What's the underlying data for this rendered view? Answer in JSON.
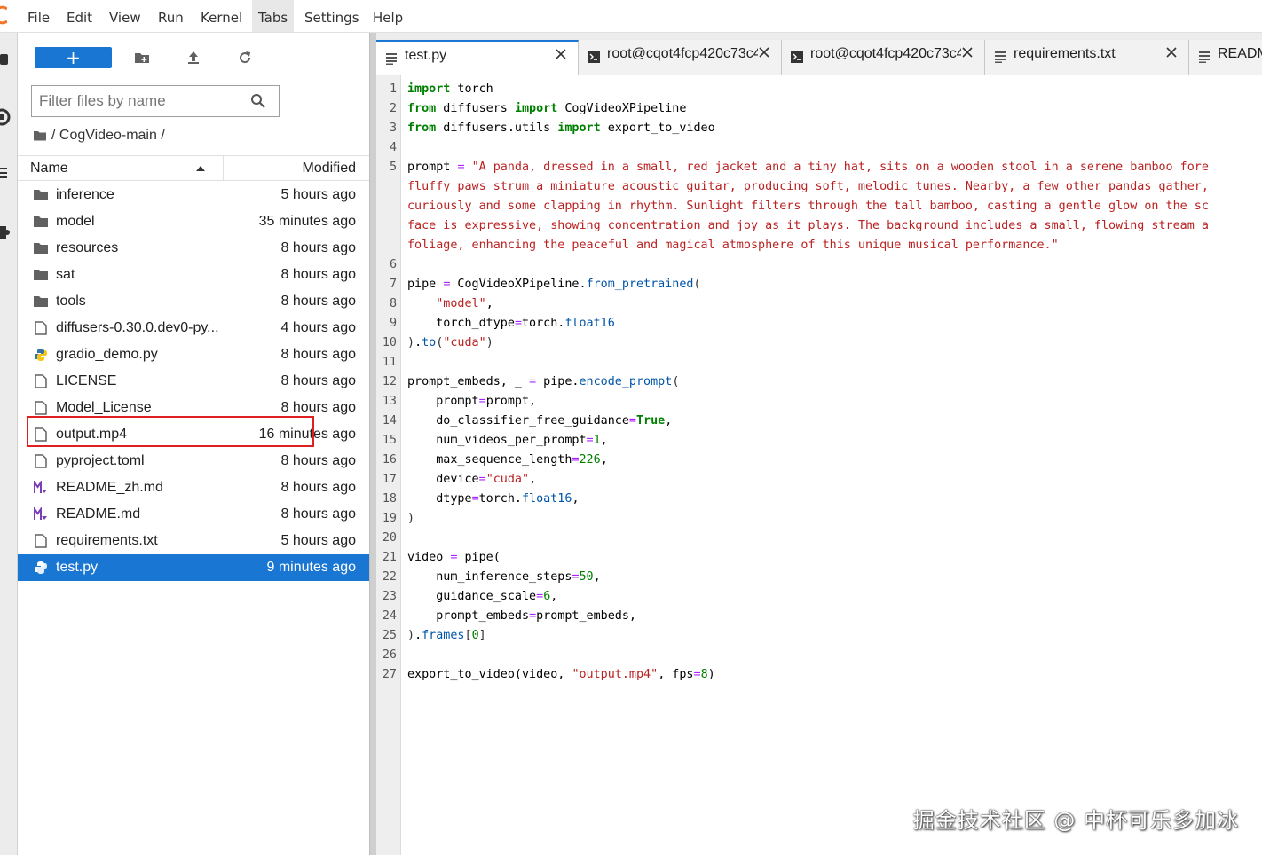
{
  "menubar": {
    "items": [
      "File",
      "Edit",
      "View",
      "Run",
      "Kernel",
      "Tabs",
      "Settings",
      "Help"
    ],
    "active": "Tabs"
  },
  "toolbar": {
    "new_label": "+",
    "icons": [
      "new-folder-icon",
      "upload-icon",
      "refresh-icon"
    ]
  },
  "filter": {
    "placeholder": "Filter files by name",
    "value": ""
  },
  "breadcrumb": {
    "path": "/ CogVideo-main /"
  },
  "list_header": {
    "name": "Name",
    "modified": "Modified",
    "sort": "ascending"
  },
  "files": [
    {
      "name": "inference",
      "modified": "5 hours ago",
      "type": "folder"
    },
    {
      "name": "model",
      "modified": "35 minutes ago",
      "type": "folder"
    },
    {
      "name": "resources",
      "modified": "8 hours ago",
      "type": "folder"
    },
    {
      "name": "sat",
      "modified": "8 hours ago",
      "type": "folder"
    },
    {
      "name": "tools",
      "modified": "8 hours ago",
      "type": "folder"
    },
    {
      "name": "diffusers-0.30.0.dev0-py...",
      "modified": "4 hours ago",
      "type": "file"
    },
    {
      "name": "gradio_demo.py",
      "modified": "8 hours ago",
      "type": "python"
    },
    {
      "name": "LICENSE",
      "modified": "8 hours ago",
      "type": "file"
    },
    {
      "name": "Model_License",
      "modified": "8 hours ago",
      "type": "file"
    },
    {
      "name": "output.mp4",
      "modified": "16 minutes ago",
      "type": "file",
      "highlighted": true
    },
    {
      "name": "pyproject.toml",
      "modified": "8 hours ago",
      "type": "file"
    },
    {
      "name": "README_zh.md",
      "modified": "8 hours ago",
      "type": "markdown"
    },
    {
      "name": "README.md",
      "modified": "8 hours ago",
      "type": "markdown"
    },
    {
      "name": "requirements.txt",
      "modified": "5 hours ago",
      "type": "file"
    },
    {
      "name": "test.py",
      "modified": "9 minutes ago",
      "type": "python",
      "selected": true
    }
  ],
  "tabs": [
    {
      "label": "test.py",
      "icon": "text-file-icon",
      "active": true
    },
    {
      "label": "root@cqot4fcp420c73c4",
      "icon": "terminal-icon"
    },
    {
      "label": "root@cqot4fcp420c73c4",
      "icon": "terminal-icon"
    },
    {
      "label": "requirements.txt",
      "icon": "text-file-icon"
    },
    {
      "label": "READM",
      "icon": "text-file-icon"
    }
  ],
  "code": {
    "line_numbers": [
      "1",
      "2",
      "3",
      "4",
      "5",
      "",
      "",
      "",
      "",
      "6",
      "7",
      "8",
      "9",
      "10",
      "11",
      "12",
      "13",
      "14",
      "15",
      "16",
      "17",
      "18",
      "19",
      "20",
      "21",
      "22",
      "23",
      "24",
      "25",
      "26",
      "27"
    ],
    "lines": [
      [
        [
          "kw",
          "import"
        ],
        [
          "t",
          " torch"
        ]
      ],
      [
        [
          "kw",
          "from"
        ],
        [
          "t",
          " diffusers "
        ],
        [
          "kw",
          "import"
        ],
        [
          "t",
          " CogVideoXPipeline"
        ]
      ],
      [
        [
          "kw",
          "from"
        ],
        [
          "t",
          " diffusers.utils "
        ],
        [
          "kw",
          "import"
        ],
        [
          "t",
          " export_to_video"
        ]
      ],
      [],
      [
        [
          "t",
          "prompt "
        ],
        [
          "op",
          "="
        ],
        [
          "t",
          " "
        ],
        [
          "str",
          "\"A panda, dressed in a small, red jacket and a tiny hat, sits on a wooden stool in a serene bamboo fore"
        ]
      ],
      [
        [
          "str",
          "fluffy paws strum a miniature acoustic guitar, producing soft, melodic tunes. Nearby, a few other pandas gather,"
        ]
      ],
      [
        [
          "str",
          "curiously and some clapping in rhythm. Sunlight filters through the tall bamboo, casting a gentle glow on the sc"
        ]
      ],
      [
        [
          "str",
          "face is expressive, showing concentration and joy as it plays. The background includes a small, flowing stream a"
        ]
      ],
      [
        [
          "str",
          "foliage, enhancing the peaceful and magical atmosphere of this unique musical performance.\""
        ]
      ],
      [],
      [
        [
          "t",
          "pipe "
        ],
        [
          "op",
          "="
        ],
        [
          "t",
          " CogVideoXPipeline."
        ],
        [
          "attr",
          "from_pretrained"
        ],
        [
          "brk",
          "("
        ]
      ],
      [
        [
          "t",
          "    "
        ],
        [
          "str",
          "\"model\""
        ],
        [
          "t",
          ","
        ]
      ],
      [
        [
          "t",
          "    torch_dtype"
        ],
        [
          "op",
          "="
        ],
        [
          "t",
          "torch."
        ],
        [
          "attr",
          "float16"
        ]
      ],
      [
        [
          "brk",
          ")"
        ],
        [
          "t",
          "."
        ],
        [
          "attr",
          "to"
        ],
        [
          "brk",
          "("
        ],
        [
          "str",
          "\"cuda\""
        ],
        [
          "brk",
          ")"
        ]
      ],
      [],
      [
        [
          "t",
          "prompt_embeds, _ "
        ],
        [
          "op",
          "="
        ],
        [
          "t",
          " pipe."
        ],
        [
          "attr",
          "encode_prompt"
        ],
        [
          "brk",
          "("
        ]
      ],
      [
        [
          "t",
          "    prompt"
        ],
        [
          "op",
          "="
        ],
        [
          "t",
          "prompt,"
        ]
      ],
      [
        [
          "t",
          "    do_classifier_free_guidance"
        ],
        [
          "op",
          "="
        ],
        [
          "kw",
          "True"
        ],
        [
          "t",
          ","
        ]
      ],
      [
        [
          "t",
          "    num_videos_per_prompt"
        ],
        [
          "op",
          "="
        ],
        [
          "num",
          "1"
        ],
        [
          "t",
          ","
        ]
      ],
      [
        [
          "t",
          "    max_sequence_length"
        ],
        [
          "op",
          "="
        ],
        [
          "num",
          "226"
        ],
        [
          "t",
          ","
        ]
      ],
      [
        [
          "t",
          "    device"
        ],
        [
          "op",
          "="
        ],
        [
          "str",
          "\"cuda\""
        ],
        [
          "t",
          ","
        ]
      ],
      [
        [
          "t",
          "    dtype"
        ],
        [
          "op",
          "="
        ],
        [
          "t",
          "torch."
        ],
        [
          "attr",
          "float16"
        ],
        [
          "t",
          ","
        ]
      ],
      [
        [
          "brk",
          ")"
        ]
      ],
      [],
      [
        [
          "t",
          "video "
        ],
        [
          "op",
          "="
        ],
        [
          "t",
          " pipe("
        ]
      ],
      [
        [
          "t",
          "    num_inference_steps"
        ],
        [
          "op",
          "="
        ],
        [
          "num",
          "50"
        ],
        [
          "t",
          ","
        ]
      ],
      [
        [
          "t",
          "    guidance_scale"
        ],
        [
          "op",
          "="
        ],
        [
          "num",
          "6"
        ],
        [
          "t",
          ","
        ]
      ],
      [
        [
          "t",
          "    prompt_embeds"
        ],
        [
          "op",
          "="
        ],
        [
          "t",
          "prompt_embeds,"
        ]
      ],
      [
        [
          "brk",
          ")"
        ],
        [
          "t",
          "."
        ],
        [
          "attr",
          "frames"
        ],
        [
          "brk",
          "["
        ],
        [
          "num",
          "0"
        ],
        [
          "brk",
          "]"
        ]
      ],
      [],
      [
        [
          "t",
          "export_to_video(video, "
        ],
        [
          "str",
          "\"output.mp4\""
        ],
        [
          "t",
          ", fps"
        ],
        [
          "op",
          "="
        ],
        [
          "num",
          "8"
        ],
        [
          "t",
          ")"
        ]
      ]
    ]
  },
  "watermark": "掘金技术社区 @ 中杯可乐多加冰",
  "colors": {
    "accent": "#1976d2",
    "highlight_box": "#e02020",
    "keyword": "#008000",
    "string": "#ba2121",
    "operator": "#aa22ff"
  }
}
